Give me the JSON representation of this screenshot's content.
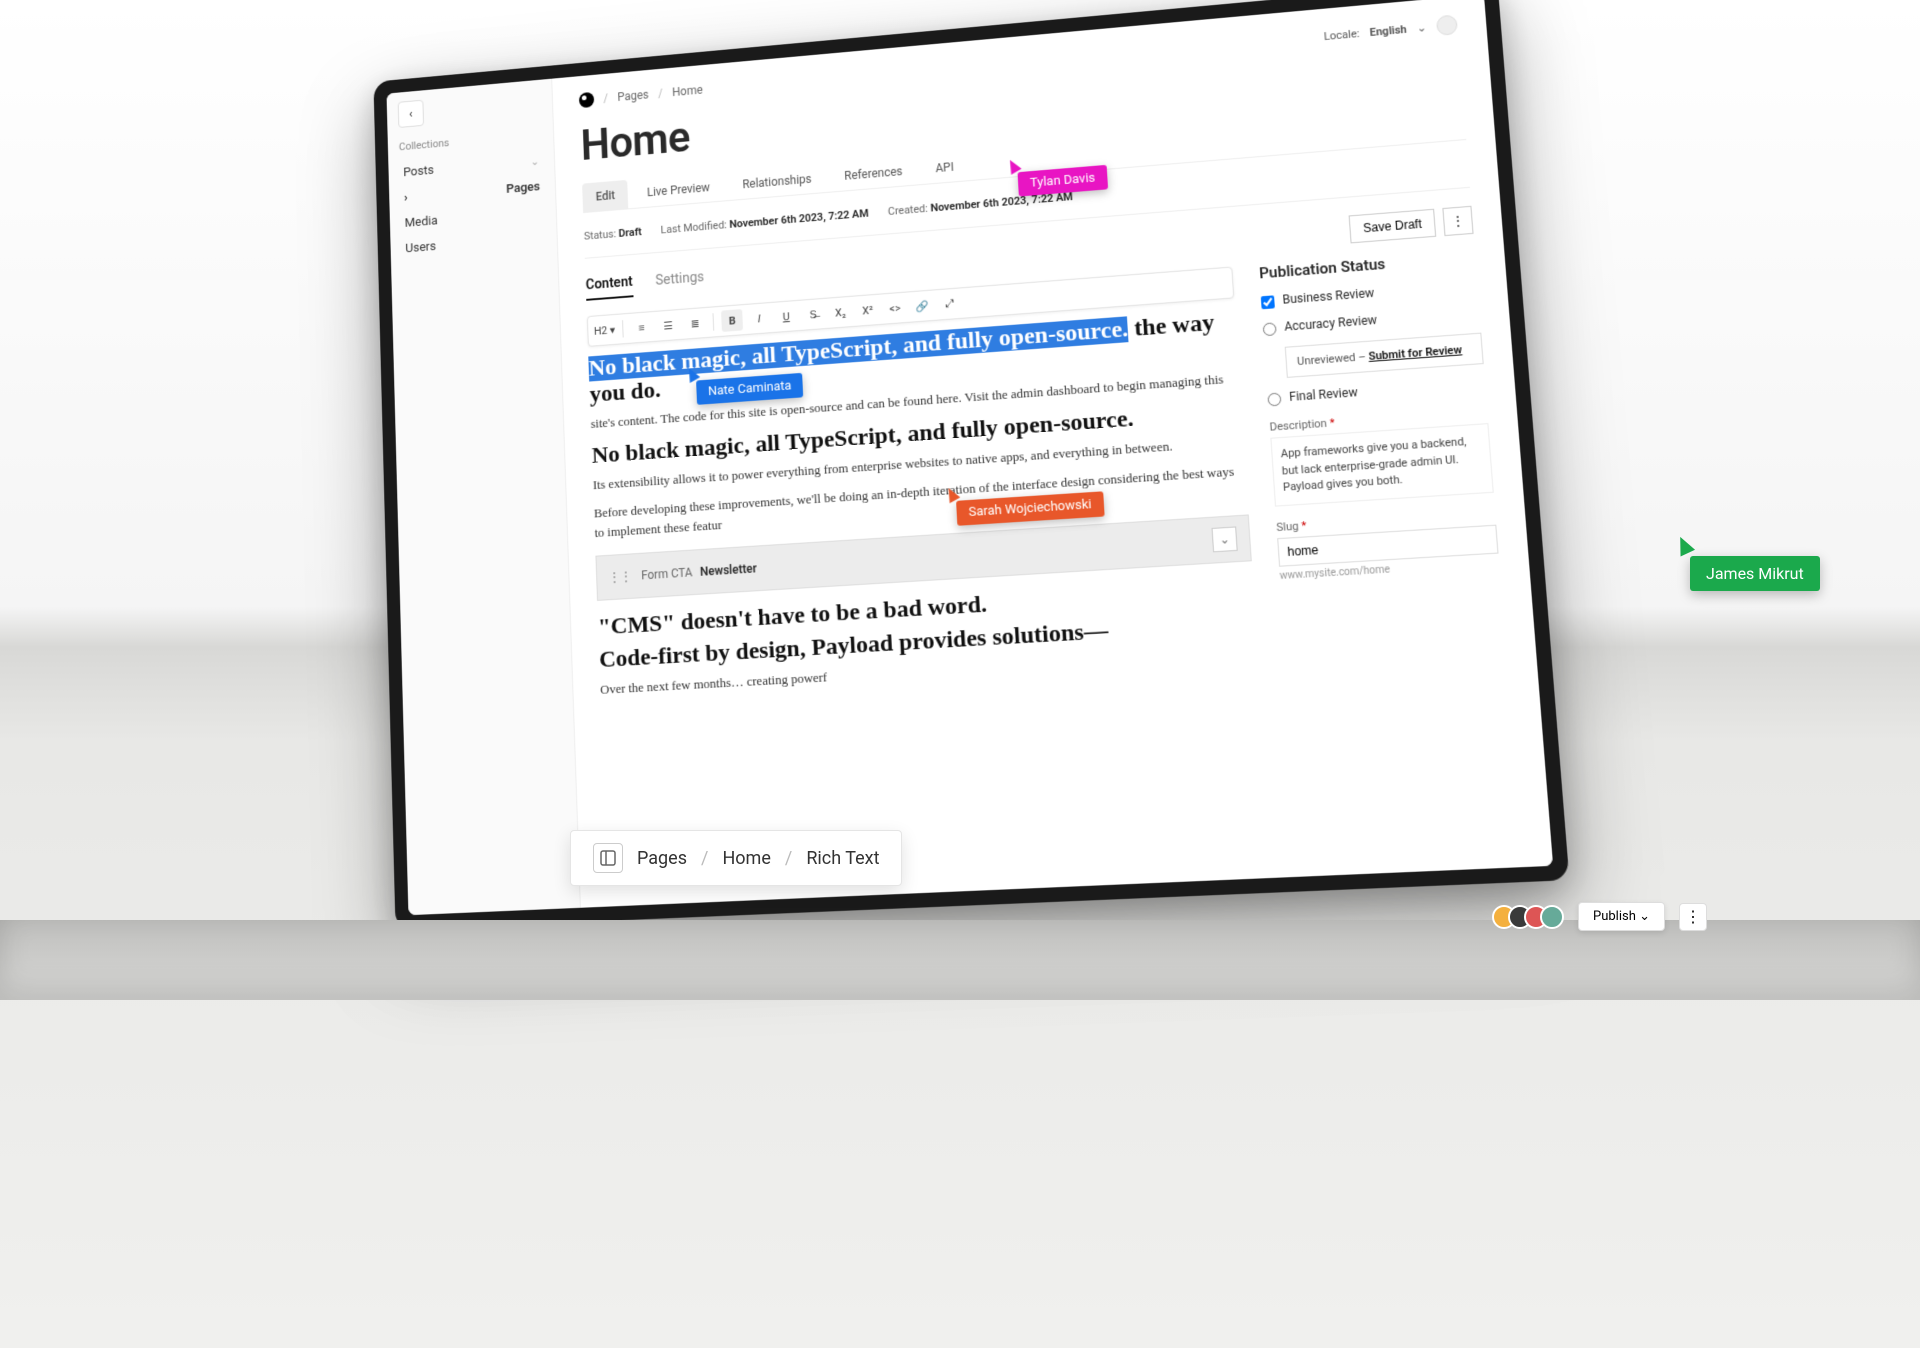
{
  "sidebar": {
    "heading": "Collections",
    "items": [
      {
        "label": "Posts",
        "expandable": true
      },
      {
        "label": "Pages",
        "active": true
      },
      {
        "label": "Media"
      },
      {
        "label": "Users"
      }
    ]
  },
  "breadcrumb": {
    "items": [
      "Pages",
      "Home"
    ]
  },
  "page": {
    "title": "Home"
  },
  "locale": {
    "label": "Locale:",
    "value": "English"
  },
  "viewTabs": {
    "edit": "Edit",
    "livePreview": "Live Preview",
    "relationships": "Relationships",
    "references": "References",
    "api": "API"
  },
  "meta": {
    "statusLabel": "Status:",
    "statusValue": "Draft",
    "lastModifiedLabel": "Last Modified:",
    "lastModifiedValue": "November 6th 2023, 7:22 AM",
    "createdLabel": "Created:",
    "createdValue": "November 6th 2023, 7:22 AM"
  },
  "subTabs": {
    "content": "Content",
    "settings": "Settings"
  },
  "actions": {
    "saveDraft": "Save Draft"
  },
  "editor": {
    "highlighted": "No black magic, all TypeScript, and fully open-source.",
    "h1_tail": " the way you do.",
    "p1": "site's content. The code for this site is open-source and can be found here. Visit the admin dashboard to begin managing this",
    "h2": "No black magic, all TypeScript, and fully open-source.",
    "p2": "Its extensibility allows it to power everything from enterprise websites to native apps, and everything in between.",
    "p3": "Before developing these improvements, we'll be doing an in-depth iteration of the interface design considering the best ways to implement these featur",
    "block": {
      "type": "Form CTA",
      "name": "Newsletter"
    },
    "h3a": "\"CMS\" doesn't have to be a bad word.",
    "h3b": "Code-first by design, Payload provides solutions—",
    "p4": "Over the next few months… creating powerf"
  },
  "aside": {
    "heading": "Publication Status",
    "businessReview": "Business Review",
    "accuracyReview": "Accuracy Review",
    "unreviewedLabel": "Unreviewed –",
    "submitLink": "Submit for Review",
    "finalReview": "Final Review",
    "descriptionLabel": "Description",
    "descriptionValue": "App frameworks give you a backend, but lack enterprise-grade admin UI. Payload gives you both.",
    "slugLabel": "Slug",
    "slugValue": "home",
    "slugUrl": "www.mysite.com/home"
  },
  "collab": {
    "tylan": "Tylan Davis",
    "nate": "Nate Caminata",
    "sarah": "Sarah Wojciechowski",
    "james": "James Mikrut"
  },
  "floatBreadcrumb": {
    "items": [
      "Pages",
      "Home",
      "Rich Text"
    ]
  },
  "bottomBar": {
    "publish": "Publish"
  }
}
